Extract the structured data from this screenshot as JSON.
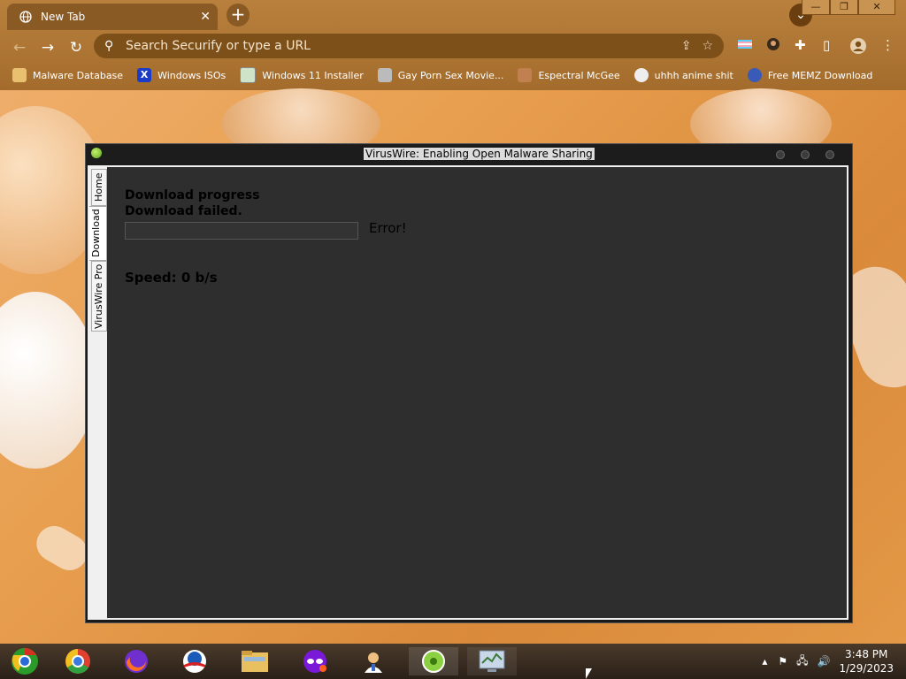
{
  "browser": {
    "tab_title": "New Tab",
    "new_tab_label": "+",
    "omnibox_placeholder": "Search Securify or type a URL",
    "bookmarks": [
      {
        "label": "Malware Database",
        "icon": "folder-icon"
      },
      {
        "label": "Windows ISOs",
        "icon": "x-logo-icon"
      },
      {
        "label": "Windows 11 Installer",
        "icon": "image-icon"
      },
      {
        "label": "Gay Porn Sex Movie...",
        "icon": "disk-icon"
      },
      {
        "label": "Espectral McGee",
        "icon": "character-icon"
      },
      {
        "label": "uhhh anime shit",
        "icon": "anime-icon"
      },
      {
        "label": "Free MEMZ Download",
        "icon": "blue-icon"
      }
    ]
  },
  "app": {
    "title": "VirusWire: Enabling Open Malware Sharing",
    "side_tabs": [
      "Home",
      "Download",
      "VirusWire Pro"
    ],
    "active_tab": "Download",
    "heading": "Download progress",
    "status": "Download failed.",
    "progress": 0,
    "error_text": "Error!",
    "speed": "Speed: 0 b/s"
  },
  "taskbar": {
    "time": "3:48 PM",
    "date": "1/29/2023",
    "pinned": [
      "chrome-legacy-icon",
      "chrome-icon",
      "firefox-icon",
      "obama-icon",
      "file-explorer-icon",
      "purple-mask-icon",
      "doctor-icon",
      "viruswire-icon",
      "task-manager-icon"
    ]
  },
  "colors": {
    "accent": "#a46c2c",
    "window_bg": "#2e2e2e"
  }
}
